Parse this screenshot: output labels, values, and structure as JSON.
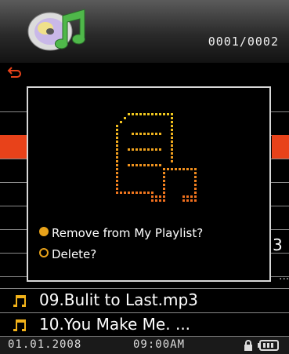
{
  "header": {
    "app_icon": "music-disc-icon",
    "track_counter": "0001/0002"
  },
  "subbar": {
    "back_icon": "back-arrow-icon"
  },
  "dialog": {
    "icon": "delete-document-icon",
    "options": [
      {
        "label": "Remove from My Playlist?",
        "selected": true
      },
      {
        "label": "Delete?",
        "selected": false
      }
    ]
  },
  "background_list": {
    "partial_text": "3",
    "partial_ellipsis": "..."
  },
  "songs": [
    {
      "title": "09.Bulit to Last.mp3",
      "icon": "music-note-icon"
    },
    {
      "title": "10.You Make Me. ...",
      "icon": "music-note-icon"
    }
  ],
  "status_bar": {
    "date": "01.01.2008",
    "time": "09:00AM",
    "lock_icon": "lock-icon",
    "battery_icon": "battery-icon"
  },
  "colors": {
    "accent": "#e8421a",
    "dot_icon": "#f0a020",
    "radio": "#e8a21a"
  }
}
